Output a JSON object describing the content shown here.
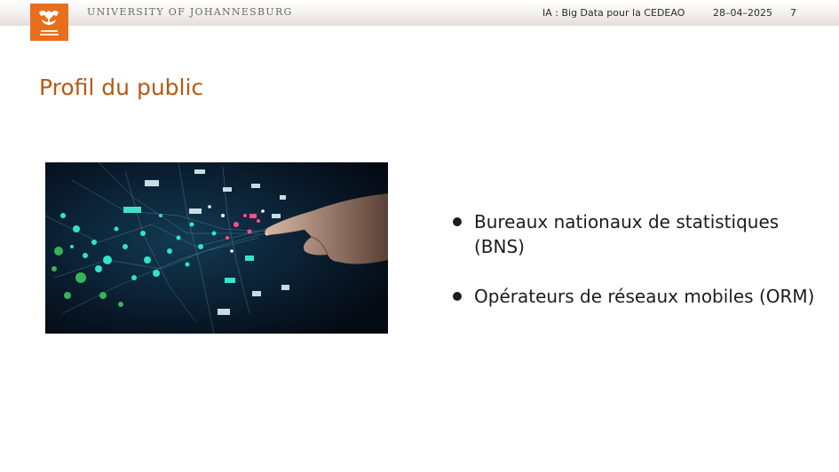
{
  "header": {
    "institution": "UNIVERSITY OF JOHANNESBURG",
    "course": "IA : Big Data pour la CEDEAO",
    "date": "28–04–2025",
    "page_number": "7",
    "logo_text": "UNIVERSITY OF JOHANNESBURG"
  },
  "slide": {
    "title": "Profil du public",
    "bullets": [
      {
        "text": "Bureaux nationaux de statistiques (BNS)"
      },
      {
        "text": "Opérateurs de réseaux mobiles (ORM)"
      }
    ],
    "image_icon": "network-data-hand-icon"
  },
  "colors": {
    "accent": "#b85914",
    "logo_bg": "#e86e1c"
  }
}
